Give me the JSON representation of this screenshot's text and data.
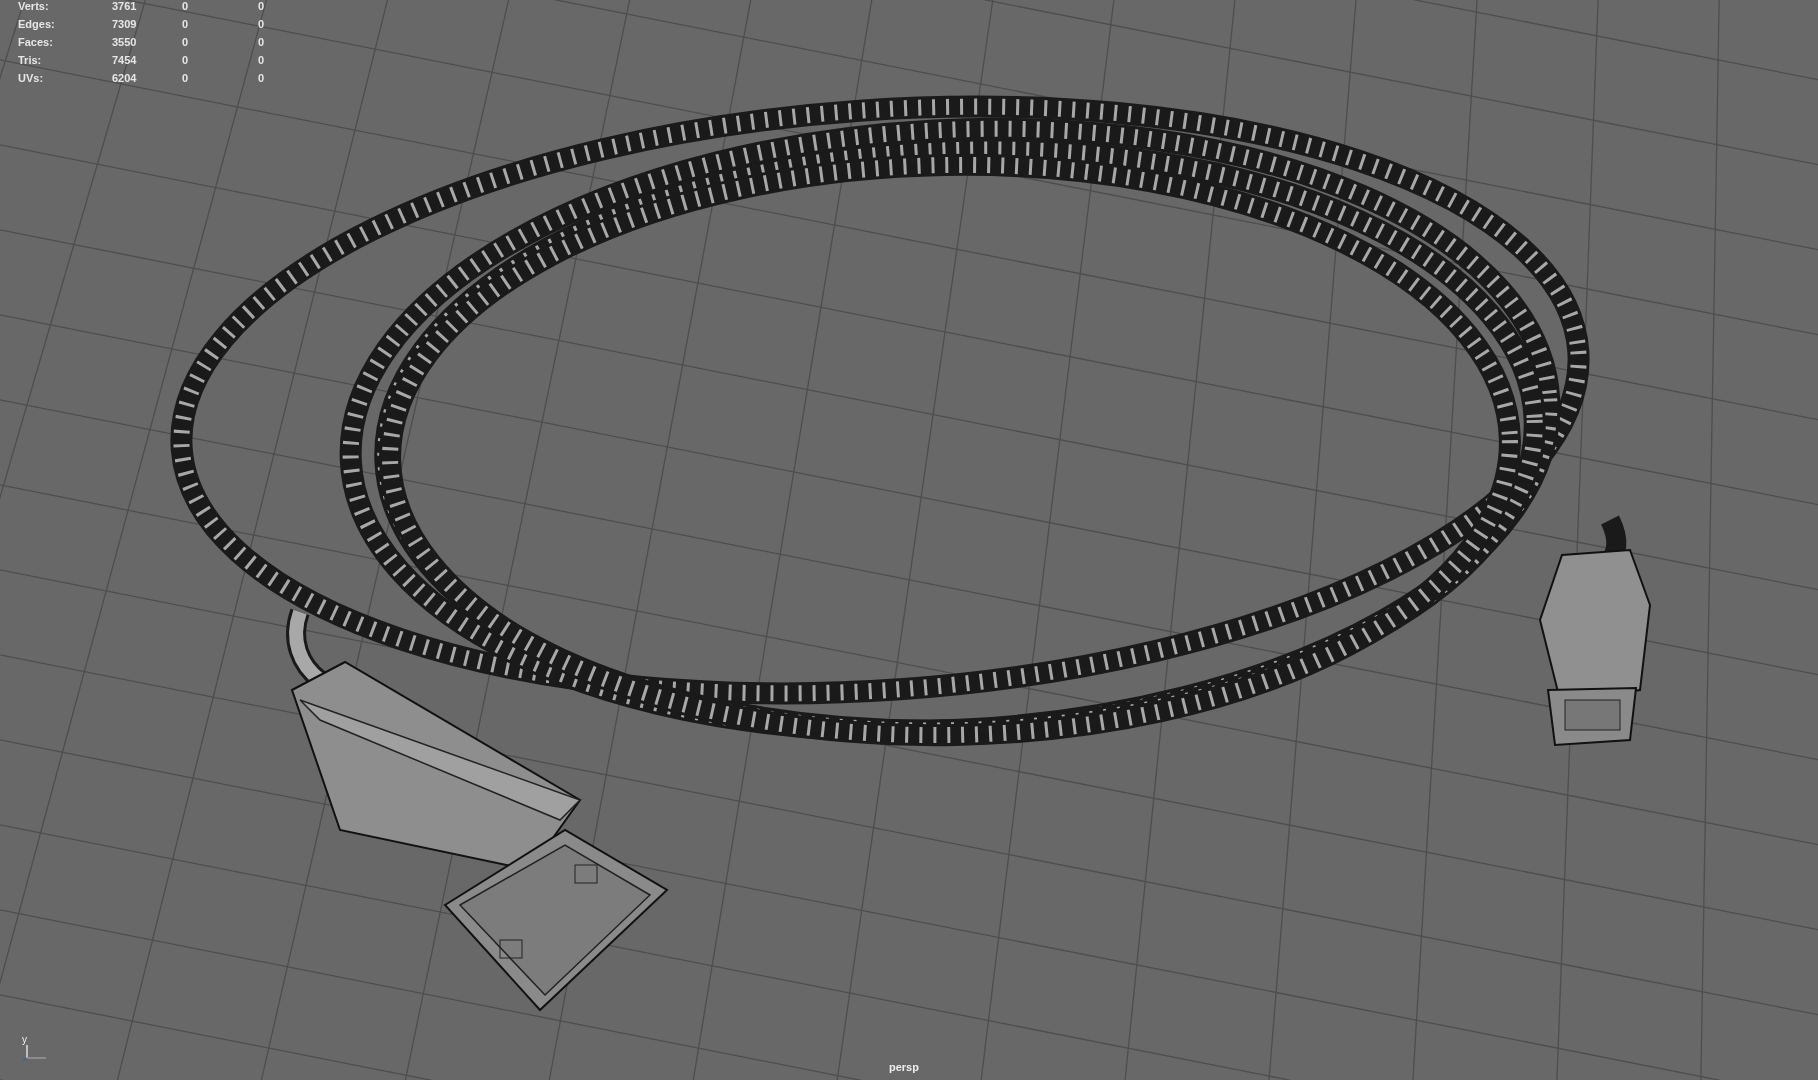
{
  "hud": {
    "rows": [
      {
        "label": "Verts:",
        "values": [
          "3761",
          "0",
          "0"
        ]
      },
      {
        "label": "Edges:",
        "values": [
          "7309",
          "0",
          "0"
        ]
      },
      {
        "label": "Faces:",
        "values": [
          "3550",
          "0",
          "0"
        ]
      },
      {
        "label": "Tris:",
        "values": [
          "7454",
          "0",
          "0"
        ]
      },
      {
        "label": "UVs:",
        "values": [
          "6204",
          "0",
          "0"
        ]
      }
    ]
  },
  "axis_label": "y",
  "camera": "persp"
}
